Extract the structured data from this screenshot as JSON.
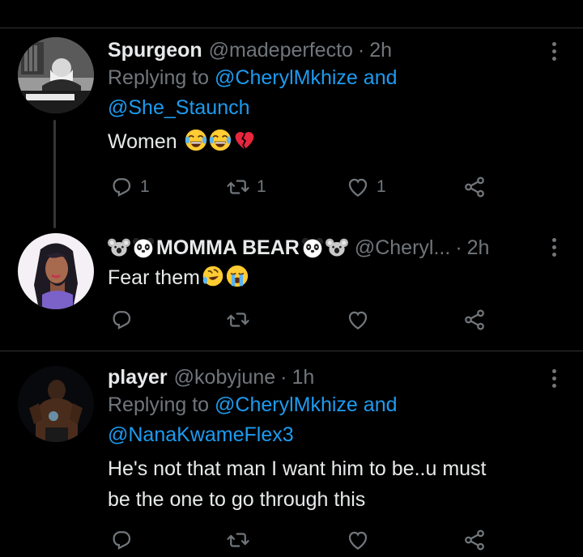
{
  "tweets": [
    {
      "name": "Spurgeon",
      "handle": "@madeperfecto",
      "dot": "·",
      "time": "2h",
      "reply_prefix": "Replying to",
      "reply_mention1": "@CherylMkhize",
      "reply_and": "and",
      "reply_mention2": "@She_Staunch",
      "text": "Women",
      "emojis": [
        "face-with-tears-of-joy",
        "face-with-tears-of-joy",
        "broken-heart"
      ],
      "reply_count": "1",
      "retweet_count": "1",
      "like_count": "1"
    },
    {
      "name": "MOMMA BEAR",
      "name_emojis_left": [
        "koala",
        "panda"
      ],
      "name_emojis_right": [
        "panda",
        "koala"
      ],
      "handle": "@Cheryl...",
      "dot": "·",
      "time": "2h",
      "text": "Fear them",
      "emojis": [
        "rolling-on-floor-laughing",
        "loudly-crying-face"
      ],
      "reply_count": "",
      "retweet_count": "",
      "like_count": ""
    },
    {
      "name": "player",
      "handle": "@kobyjune",
      "dot": "·",
      "time": "1h",
      "reply_prefix": "Replying to",
      "reply_mention1": "@CherylMkhize",
      "reply_and": "and",
      "reply_mention2": "@NanaKwameFlex3",
      "text_line1": "He's not that man I want him to be..u must",
      "text_line2": "be the one to go through this",
      "reply_count": "",
      "retweet_count": "",
      "like_count": ""
    }
  ],
  "colors": {
    "background": "#000000",
    "text": "#e7e9ea",
    "secondary": "#71767b",
    "link": "#1d9bf0",
    "divider": "#2f3336"
  }
}
